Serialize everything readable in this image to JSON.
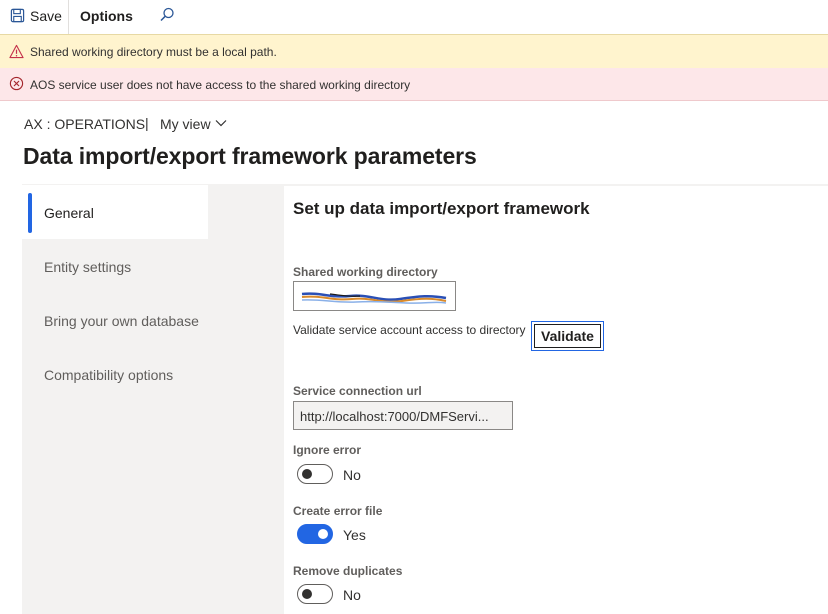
{
  "toolbar": {
    "save_label": "Save",
    "options_label": "Options"
  },
  "messages": {
    "warning": "Shared working directory must be a local path.",
    "error": "AOS service user does not have access to the shared working directory"
  },
  "breadcrumb": {
    "company": "AX : OPERATIONS",
    "separator": "|",
    "view": "My view"
  },
  "page": {
    "title": "Data import/export framework parameters"
  },
  "nav": {
    "items": [
      {
        "label": "General",
        "active": true
      },
      {
        "label": "Entity settings",
        "active": false
      },
      {
        "label": "Bring your own database",
        "active": false
      },
      {
        "label": "Compatibility options",
        "active": false
      }
    ]
  },
  "general": {
    "section_title": "Set up data import/export framework",
    "shared_dir_label": "Shared working directory",
    "shared_dir_value": "",
    "validate_text": "Validate service account access to directory",
    "validate_button": "Validate",
    "service_url_label": "Service connection url",
    "service_url_value": "http://localhost:7000/DMFServi...",
    "ignore_error_label": "Ignore error",
    "ignore_error_value": "No",
    "ignore_error_on": false,
    "create_error_file_label": "Create error file",
    "create_error_file_value": "Yes",
    "create_error_file_on": true,
    "remove_duplicates_label": "Remove duplicates",
    "remove_duplicates_value": "No",
    "remove_duplicates_on": false
  },
  "colors": {
    "accent": "#2266e3",
    "warning_bg": "#fff4ce",
    "error_bg": "#fde7e9",
    "nav_bg": "#f3f2f1"
  },
  "icons": {
    "save": "save-icon",
    "search": "search-icon",
    "warning": "warning-icon",
    "error": "error-icon",
    "chevron": "chevron-down-icon"
  }
}
